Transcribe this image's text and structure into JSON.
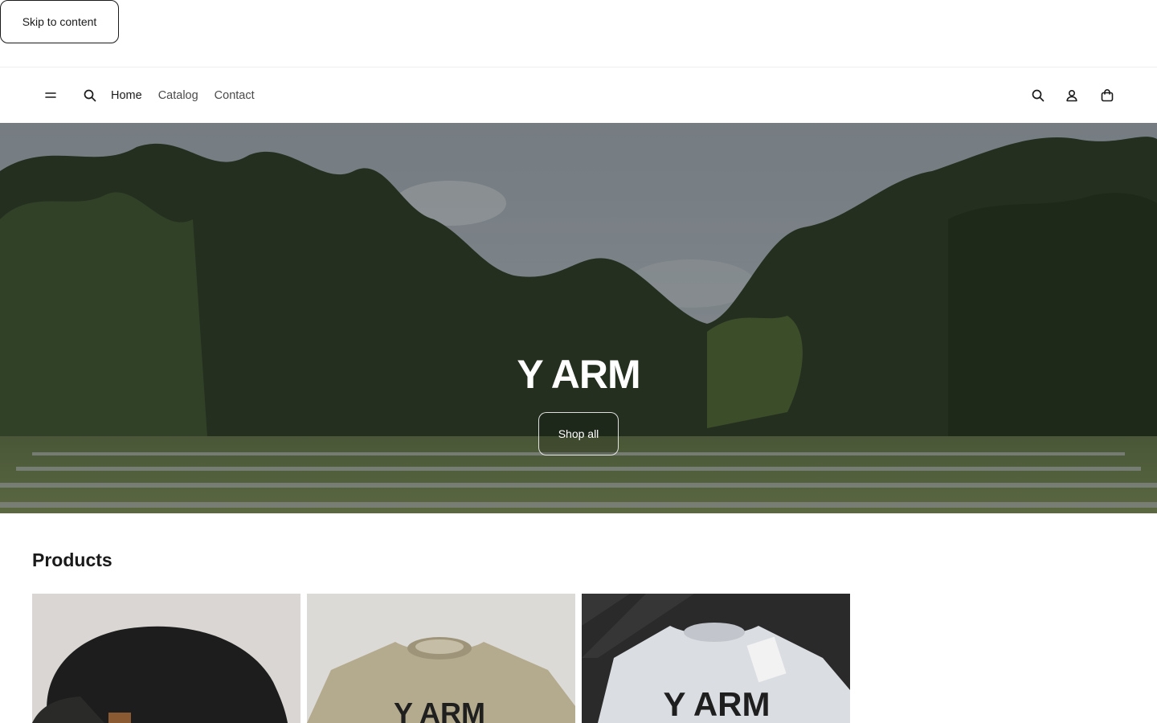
{
  "skip_link": {
    "label": "Skip to content"
  },
  "header": {
    "nav": [
      {
        "label": "Home",
        "active": true
      },
      {
        "label": "Catalog",
        "active": false
      },
      {
        "label": "Contact",
        "active": false
      }
    ],
    "icons": [
      "menu-icon",
      "search-icon",
      "search-icon",
      "account-icon",
      "cart-icon"
    ]
  },
  "hero": {
    "title": "Y ARM",
    "button_label": "Shop all"
  },
  "products": {
    "heading": "Products",
    "items": [
      {
        "image": "black-beanie-photo"
      },
      {
        "image": "tan-tshirt-photo",
        "print": "Y ARM"
      },
      {
        "image": "white-tshirt-photo",
        "print": "Y ARM"
      }
    ]
  },
  "colors": {
    "text": "#1a1a1a",
    "nav_text": "#4a4a4a",
    "background": "#ffffff"
  }
}
